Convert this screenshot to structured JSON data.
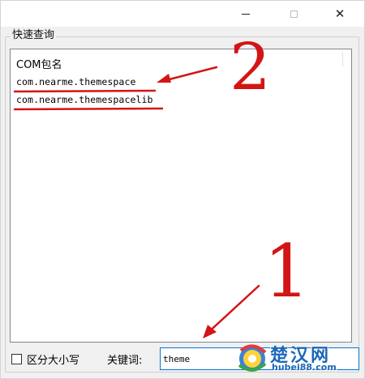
{
  "window": {
    "controls": {
      "minimize_icon": "minimize-icon",
      "maximize_icon": "maximize-icon",
      "close_glyph": "✕"
    }
  },
  "group": {
    "title": "快速查询"
  },
  "list": {
    "header": "COM包名",
    "items": [
      "com.nearme.themespace",
      "com.nearme.themespacelib"
    ]
  },
  "controls": {
    "case_sensitive_label": "区分大小写",
    "case_sensitive_checked": false,
    "keyword_label": "关键词:",
    "keyword_value": "theme"
  },
  "annotations": {
    "color": "#d31515",
    "marker_2": "2",
    "marker_1": "1"
  },
  "watermark": {
    "title": "楚汉网",
    "url": "hubei88.com"
  }
}
